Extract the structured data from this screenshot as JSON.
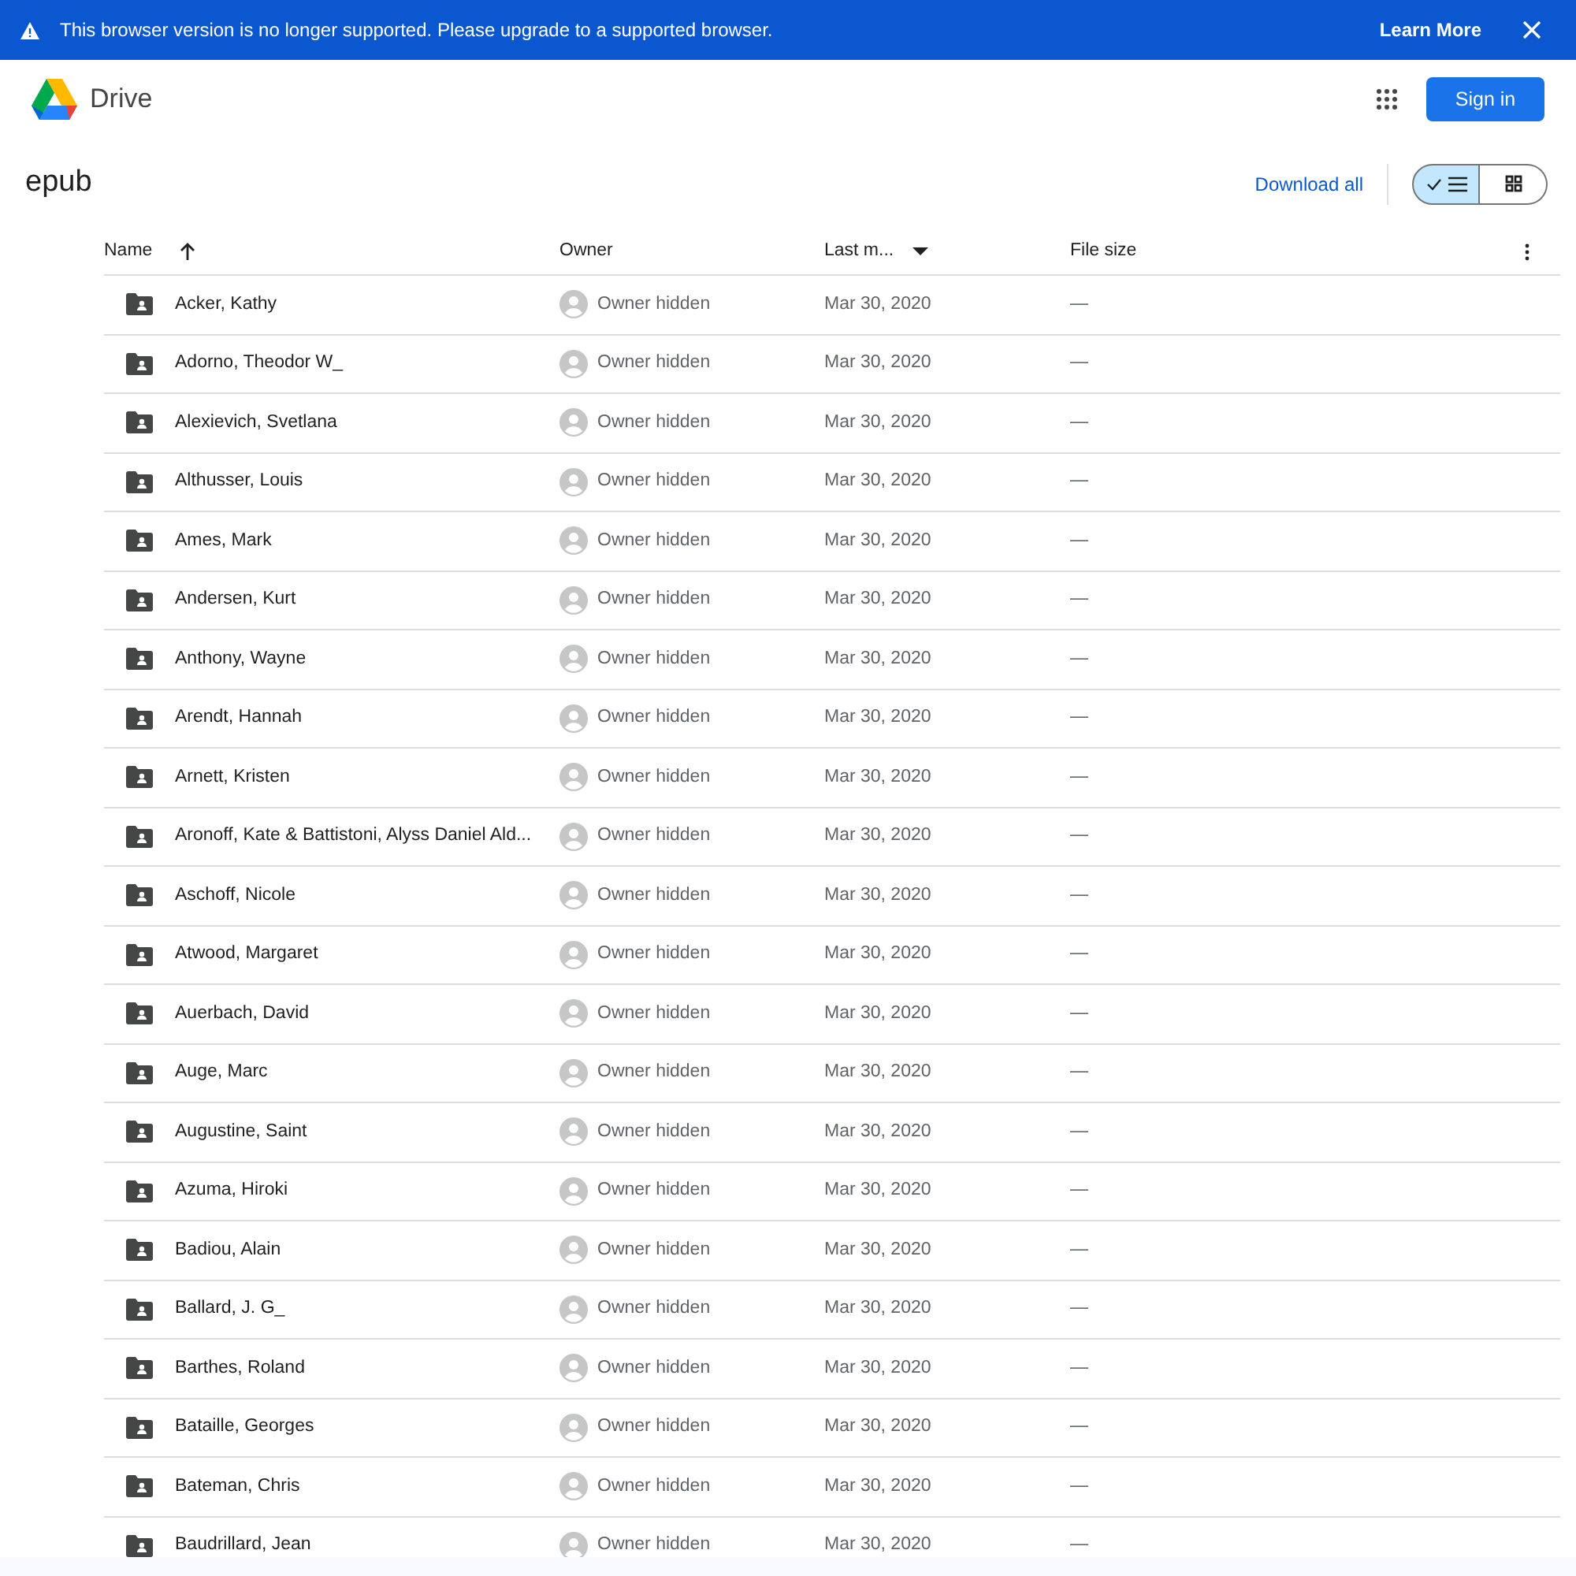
{
  "banner": {
    "message": "This browser version is no longer supported. Please upgrade to a supported browser.",
    "link": "Learn More"
  },
  "header": {
    "app_name": "Drive",
    "sign_in": "Sign in"
  },
  "folder": {
    "title": "epub",
    "download_all": "Download all",
    "view_toggle": [
      {
        "kind": "list",
        "selected": true
      },
      {
        "kind": "grid",
        "selected": false
      }
    ]
  },
  "table": {
    "columns": [
      {
        "label": "Name",
        "kind": "ascending"
      },
      {
        "label": "Owner",
        "kind": "plain"
      },
      {
        "label": "Last m...",
        "kind": "dropdown"
      },
      {
        "label": "File size",
        "kind": "plain"
      }
    ],
    "rows": [
      {
        "name": "Acker, Kathy",
        "owner": "Owner hidden",
        "modified": "Mar 30, 2020",
        "size": "—"
      },
      {
        "name": "Adorno, Theodor W_",
        "owner": "Owner hidden",
        "modified": "Mar 30, 2020",
        "size": "—"
      },
      {
        "name": "Alexievich, Svetlana",
        "owner": "Owner hidden",
        "modified": "Mar 30, 2020",
        "size": "—"
      },
      {
        "name": "Althusser, Louis",
        "owner": "Owner hidden",
        "modified": "Mar 30, 2020",
        "size": "—"
      },
      {
        "name": "Ames, Mark",
        "owner": "Owner hidden",
        "modified": "Mar 30, 2020",
        "size": "—"
      },
      {
        "name": "Andersen, Kurt",
        "owner": "Owner hidden",
        "modified": "Mar 30, 2020",
        "size": "—"
      },
      {
        "name": "Anthony, Wayne",
        "owner": "Owner hidden",
        "modified": "Mar 30, 2020",
        "size": "—"
      },
      {
        "name": "Arendt, Hannah",
        "owner": "Owner hidden",
        "modified": "Mar 30, 2020",
        "size": "—"
      },
      {
        "name": "Arnett, Kristen",
        "owner": "Owner hidden",
        "modified": "Mar 30, 2020",
        "size": "—"
      },
      {
        "name": "Aronoff, Kate & Battistoni, Alyss Daniel Ald...",
        "owner": "Owner hidden",
        "modified": "Mar 30, 2020",
        "size": "—"
      },
      {
        "name": "Aschoff, Nicole",
        "owner": "Owner hidden",
        "modified": "Mar 30, 2020",
        "size": "—"
      },
      {
        "name": "Atwood, Margaret",
        "owner": "Owner hidden",
        "modified": "Mar 30, 2020",
        "size": "—"
      },
      {
        "name": "Auerbach, David",
        "owner": "Owner hidden",
        "modified": "Mar 30, 2020",
        "size": "—"
      },
      {
        "name": "Auge, Marc",
        "owner": "Owner hidden",
        "modified": "Mar 30, 2020",
        "size": "—"
      },
      {
        "name": "Augustine, Saint",
        "owner": "Owner hidden",
        "modified": "Mar 30, 2020",
        "size": "—"
      },
      {
        "name": "Azuma, Hiroki",
        "owner": "Owner hidden",
        "modified": "Mar 30, 2020",
        "size": "—"
      },
      {
        "name": "Badiou, Alain",
        "owner": "Owner hidden",
        "modified": "Mar 30, 2020",
        "size": "—"
      },
      {
        "name": "Ballard, J. G_",
        "owner": "Owner hidden",
        "modified": "Mar 30, 2020",
        "size": "—"
      },
      {
        "name": "Barthes, Roland",
        "owner": "Owner hidden",
        "modified": "Mar 30, 2020",
        "size": "—"
      },
      {
        "name": "Bataille, Georges",
        "owner": "Owner hidden",
        "modified": "Mar 30, 2020",
        "size": "—"
      },
      {
        "name": "Bateman, Chris",
        "owner": "Owner hidden",
        "modified": "Mar 30, 2020",
        "size": "—"
      },
      {
        "name": "Baudrillard, Jean",
        "owner": "Owner hidden",
        "modified": "Mar 30, 2020",
        "size": "—"
      }
    ]
  }
}
